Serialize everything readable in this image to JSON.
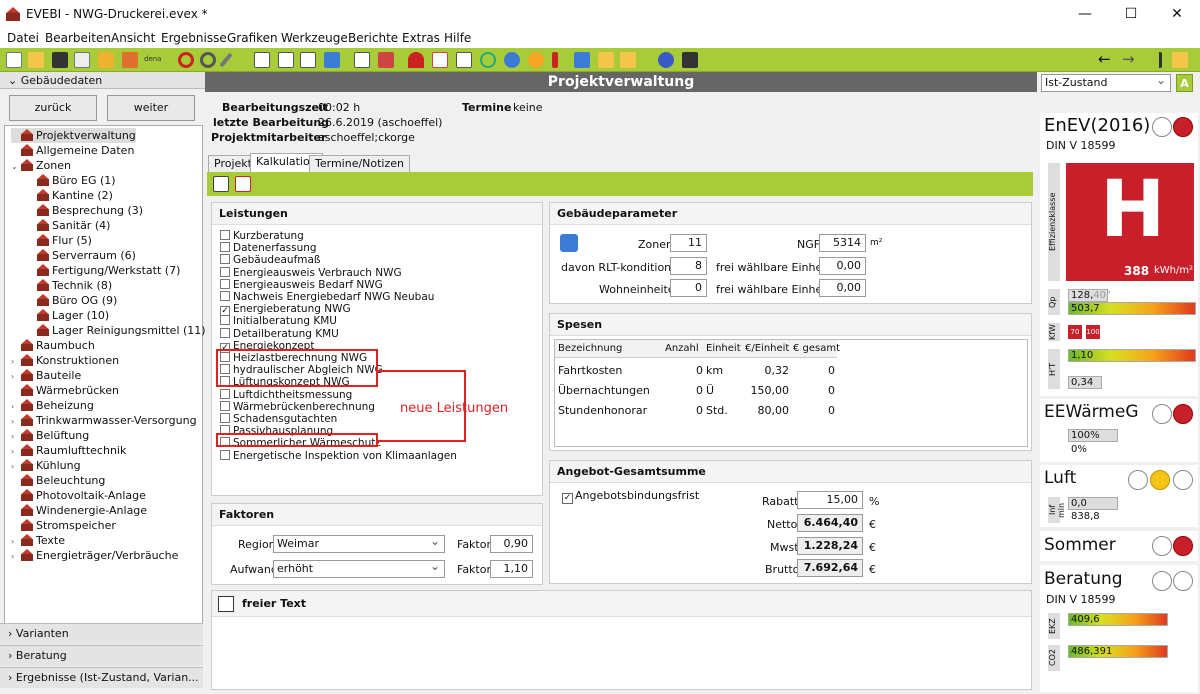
{
  "window": {
    "title": "EVEBI - NWG-Druckerei.evex *",
    "min": "—",
    "max": "☐",
    "close": "✕"
  },
  "menu": [
    "Datei",
    "Bearbeiten",
    "Ansicht",
    "Ergebnisse",
    "Grafiken",
    "Werkzeuge",
    "Berichte",
    "Extras",
    "Hilfe"
  ],
  "toolbar": {
    "dena": "dena",
    "back": "←",
    "forward": "→"
  },
  "left": {
    "header": "Gebäudedaten",
    "back_label": "zurück",
    "next_label": "weiter",
    "tree": [
      {
        "label": "Projektverwaltung",
        "level": 1,
        "exp": ""
      },
      {
        "label": "Allgemeine Daten",
        "level": 1,
        "exp": ""
      },
      {
        "label": "Zonen",
        "level": 1,
        "exp": "⌄"
      },
      {
        "label": "Büro EG (1)",
        "level": 2,
        "exp": ""
      },
      {
        "label": "Kantine (2)",
        "level": 2,
        "exp": ""
      },
      {
        "label": "Besprechung (3)",
        "level": 2,
        "exp": ""
      },
      {
        "label": "Sanitär (4)",
        "level": 2,
        "exp": ""
      },
      {
        "label": "Flur (5)",
        "level": 2,
        "exp": ""
      },
      {
        "label": "Serverraum (6)",
        "level": 2,
        "exp": ""
      },
      {
        "label": "Fertigung/Werkstatt (7)",
        "level": 2,
        "exp": ""
      },
      {
        "label": "Technik (8)",
        "level": 2,
        "exp": ""
      },
      {
        "label": "Büro OG (9)",
        "level": 2,
        "exp": ""
      },
      {
        "label": "Lager (10)",
        "level": 2,
        "exp": ""
      },
      {
        "label": "Lager Reinigungsmittel (11)",
        "level": 2,
        "exp": ""
      },
      {
        "label": "Raumbuch",
        "level": 1,
        "exp": ""
      },
      {
        "label": "Konstruktionen",
        "level": 1,
        "exp": "›"
      },
      {
        "label": "Bauteile",
        "level": 1,
        "exp": "›"
      },
      {
        "label": "Wärmebrücken",
        "level": 1,
        "exp": ""
      },
      {
        "label": "Beheizung",
        "level": 1,
        "exp": "›"
      },
      {
        "label": "Trinkwarmwasser-Versorgung",
        "level": 1,
        "exp": "›"
      },
      {
        "label": "Belüftung",
        "level": 1,
        "exp": "›"
      },
      {
        "label": "Raumlufttechnik",
        "level": 1,
        "exp": "›"
      },
      {
        "label": "Kühlung",
        "level": 1,
        "exp": "›"
      },
      {
        "label": "Beleuchtung",
        "level": 1,
        "exp": ""
      },
      {
        "label": "Photovoltaik-Anlage",
        "level": 1,
        "exp": ""
      },
      {
        "label": "Windenergie-Anlage",
        "level": 1,
        "exp": ""
      },
      {
        "label": "Stromspeicher",
        "level": 1,
        "exp": ""
      },
      {
        "label": "Texte",
        "level": 1,
        "exp": "›"
      },
      {
        "label": "Energieträger/Verbräuche",
        "level": 1,
        "exp": "›"
      }
    ],
    "footer": [
      "Varianten",
      "Beratung",
      "Ergebnisse (Ist-Zustand, Varian..."
    ]
  },
  "center": {
    "title": "Projektverwaltung",
    "info": {
      "bearbeitungszeit_label": "Bearbeitungszeit",
      "bearbeitungszeit": "00:02 h",
      "letzte_label": "letzte Bearbeitung",
      "letzte": "26.6.2019 (aschoeffel)",
      "mitarbeiter_label": "Projektmitarbeiter",
      "mitarbeiter": "aschoeffel;ckorge",
      "termine_label": "Termine",
      "termine": "keine"
    },
    "tabs": [
      "Projekt",
      "Kalkulation",
      "Termine/Notizen"
    ],
    "leistungen": {
      "title": "Leistungen",
      "items": [
        {
          "label": "Kurzberatung",
          "checked": ""
        },
        {
          "label": "Datenerfassung",
          "checked": ""
        },
        {
          "label": "Gebäudeaufmaß",
          "checked": ""
        },
        {
          "label": "Energieausweis Verbrauch NWG",
          "checked": ""
        },
        {
          "label": "Energieausweis Bedarf NWG",
          "checked": ""
        },
        {
          "label": "Nachweis Energiebedarf NWG Neubau",
          "checked": ""
        },
        {
          "label": "Energieberatung NWG",
          "checked": "✓"
        },
        {
          "label": "Initialberatung KMU",
          "checked": ""
        },
        {
          "label": "Detailberatung KMU",
          "checked": ""
        },
        {
          "label": "Energiekonzept",
          "checked": "✓"
        },
        {
          "label": "Heizlastberechnung NWG",
          "checked": ""
        },
        {
          "label": "hydraulischer Abgleich NWG",
          "checked": ""
        },
        {
          "label": "Lüftungskonzept NWG",
          "checked": ""
        },
        {
          "label": "Luftdichtheitsmessung",
          "checked": ""
        },
        {
          "label": "Wärmebrückenberechnung",
          "checked": ""
        },
        {
          "label": "Schadensgutachten",
          "checked": ""
        },
        {
          "label": "Passivhausplanung",
          "checked": ""
        },
        {
          "label": "Sommerlicher Wärmeschutz",
          "checked": ""
        },
        {
          "label": "Energetische Inspektion von Klimaanlagen",
          "checked": ""
        }
      ],
      "annotation": "neue Leistungen"
    },
    "faktoren": {
      "title": "Faktoren",
      "region_label": "Region",
      "region": "Weimar",
      "faktor_label": "Faktor",
      "region_factor": "0,90",
      "aufwand_label": "Aufwand",
      "aufwand": "erhöht",
      "aufwand_factor": "1,10"
    },
    "gebaeude": {
      "title": "Gebäudeparameter",
      "zonen_label": "Zonen",
      "zonen": "11",
      "ngf_label": "NGF",
      "ngf": "5314",
      "ngf_unit": "m²",
      "rlt_label": "davon RLT-konditioniert",
      "rlt": "8",
      "fe1_label": "frei wählbare Einheit 1",
      "fe1": "0,00",
      "wohn_label": "Wohneinheiten",
      "wohn": "0",
      "fe2_label": "frei wählbare Einheit 2",
      "fe2": "0,00"
    },
    "spesen": {
      "title": "Spesen",
      "headers": [
        "Bezeichnung",
        "Anzahl",
        "Einheit",
        "€/Einheit",
        "€ gesamt"
      ],
      "rows": [
        [
          "Fahrtkosten",
          "0",
          "km",
          "0,32",
          "0"
        ],
        [
          "Übernachtungen",
          "0",
          "Ü",
          "150,00",
          "0"
        ],
        [
          "Stundenhonorar",
          "0",
          "Std.",
          "80,00",
          "0"
        ]
      ]
    },
    "angebot": {
      "title": "Angebot-Gesamtsumme",
      "bindung_label": "Angebotsbindungsfrist",
      "bindung_check": "✓",
      "rabatt_label": "Rabatt",
      "rabatt": "15,00",
      "rabatt_unit": "%",
      "netto_label": "Netto",
      "netto": "6.464,40",
      "mwst_label": "Mwst",
      "mwst": "1.228,24",
      "brutto_label": "Brutto",
      "brutto": "7.692,64",
      "eur": "€"
    },
    "freitext": {
      "title": "freier Text"
    }
  },
  "right": {
    "variant": "Ist-Zustand",
    "a_badge": "A",
    "enev": {
      "title": "EnEV(2016)",
      "sub": "DIN V 18599",
      "class": "H",
      "value": "388",
      "unit": "kWh/m²",
      "eff_label": "Effizienzklasse"
    },
    "qp": {
      "label": "Qp",
      "v1": "128,",
      "v1b": "40°",
      "v2": "503,7"
    },
    "kw": {
      "label": "KfW",
      "b1": "70",
      "b2": "100"
    },
    "ht": {
      "label": "H'T",
      "v1": "1,10",
      "v2": "0,34"
    },
    "eew": {
      "title": "EEWärmeG",
      "v1": "100%",
      "v2": "0%"
    },
    "luft": {
      "title": "Luft",
      "label": "Inf min",
      "v1": "0,0",
      "v2": "838,8"
    },
    "sommer": {
      "title": "Sommer"
    },
    "beratung": {
      "title": "Beratung",
      "sub": "DIN V 18599",
      "ekz_label": "EKZ",
      "ekz": "409,6",
      "co2_label": "CO2",
      "co2": "486,391"
    },
    "colors": {
      "red": "#c8202a",
      "yellow": "#f5c518",
      "green": "#a8cb3a"
    }
  }
}
